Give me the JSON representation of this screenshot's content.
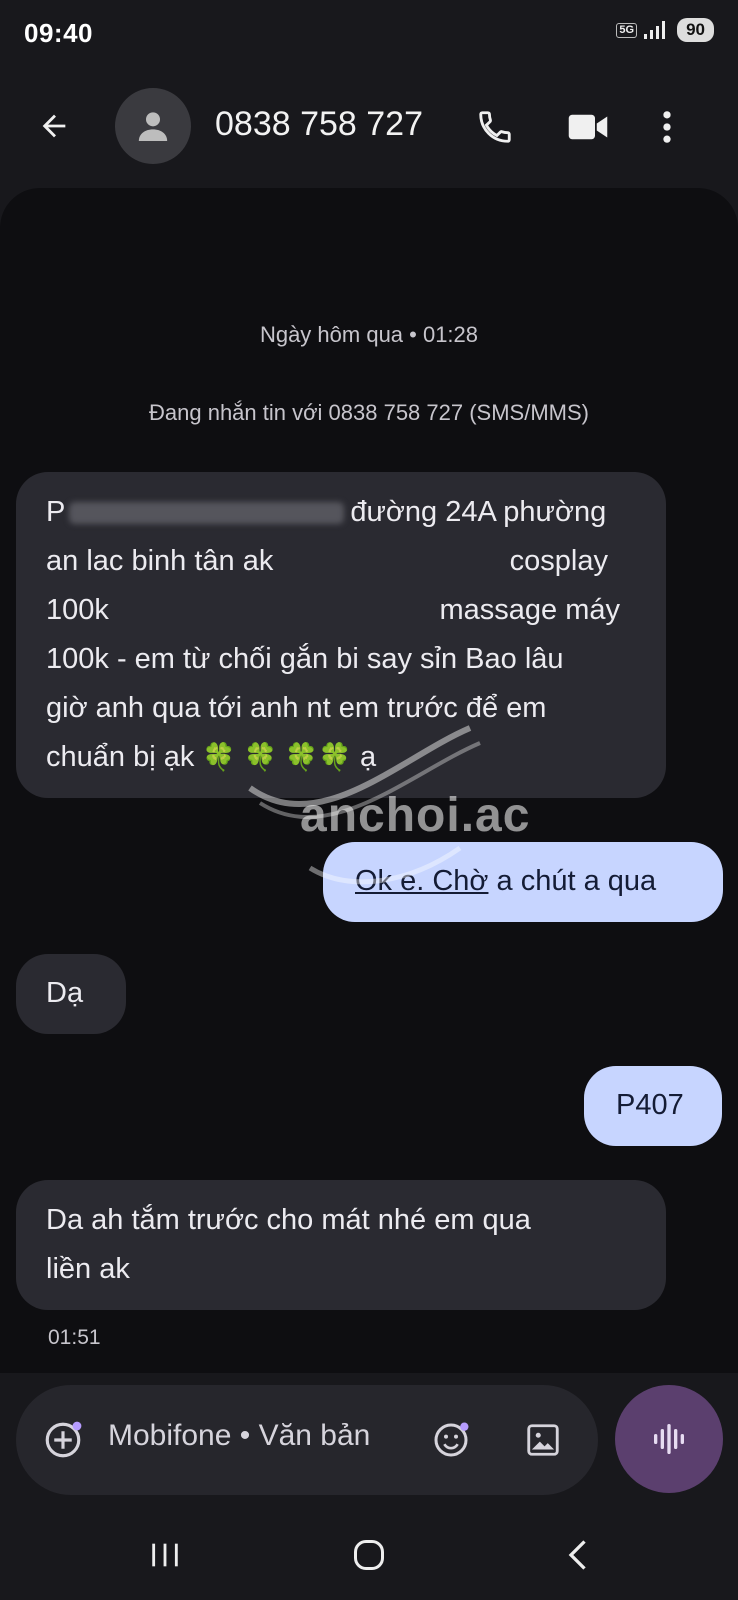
{
  "status_bar": {
    "time": "09:40",
    "network": "5G",
    "battery": "90"
  },
  "header": {
    "contact": "0838 758 727",
    "icons": [
      "arrow-back-icon",
      "person-icon",
      "phone-icon",
      "video-icon",
      "more-vert-icon"
    ]
  },
  "thread": {
    "date_label": "Ngày hôm qua • 01:28",
    "info_label": "Đang nhắn tin với 0838 758 727 (SMS/MMS)",
    "messages": [
      {
        "direction": "in",
        "parts": {
          "p1_start": "P",
          "p1_end": "đường 24A phường",
          "p2_start": "an lac binh tân ak",
          "p2_end": "cosplay",
          "p3_start": "100k",
          "p3_end": "massage máy",
          "p4": "100k - em từ chối gắn bi say sỉn Bao lâu",
          "p5": "giờ anh qua tới anh nt em trước để em",
          "p6_start": "chuẩn bị ạk",
          "clovers": "🍀 🍀 🍀🍀",
          "p6_end": "ạ"
        }
      },
      {
        "direction": "out",
        "text_underlined": "Ok e. Chờ",
        "text_rest": " a chút a qua"
      },
      {
        "direction": "in",
        "text": "Dạ"
      },
      {
        "direction": "out",
        "text": "P407"
      },
      {
        "direction": "in",
        "line1": "Da ah tắm trước cho mát nhé em qua",
        "line2": "liền ak"
      }
    ],
    "last_time": "01:51"
  },
  "watermark": "anchoi.ac",
  "compose": {
    "hint": "Mobifone • Văn bản"
  },
  "colors": {
    "background": "#18181c",
    "thread_bg": "#0e0e11",
    "incoming_bubble": "#2a2a31",
    "outgoing_bubble": "#c7d5ff",
    "voice_button": "#5b3f6e"
  }
}
